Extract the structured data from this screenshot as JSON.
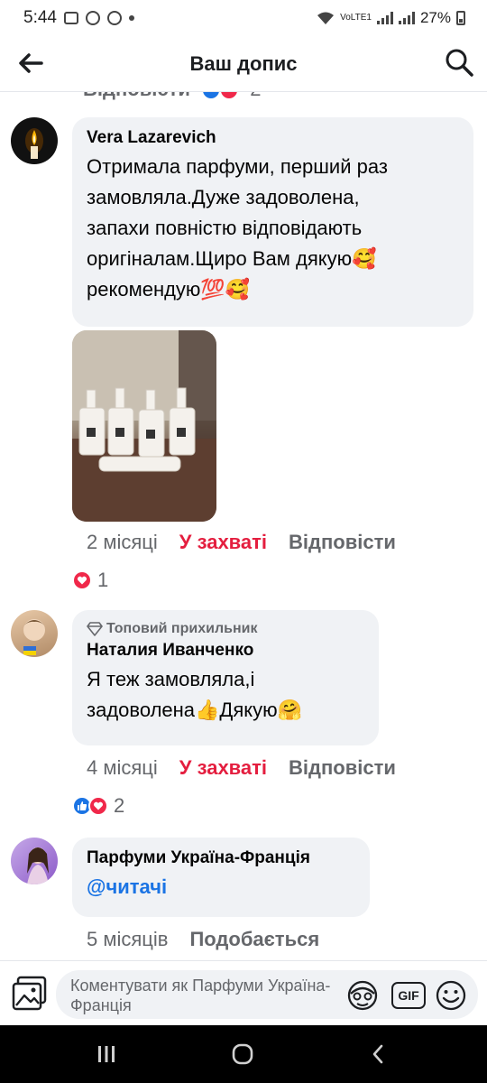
{
  "status_bar": {
    "time": "5:44",
    "network": "VoLTE1",
    "battery": "27%"
  },
  "header": {
    "title": "Ваш допис"
  },
  "previous_comment": {
    "cut_text": "Відповісти",
    "reactions_count": "2"
  },
  "comments": [
    {
      "author": "Vera Lazarevich",
      "text_lines": [
        "Отримала парфуми, перший  раз",
        "замовляла.Дуже задоволена,",
        "запахи повністю відповідають",
        "оригіналам.Щиро Вам дякую🥰",
        "рекомендую💯🥰"
      ],
      "time": "2 місяці",
      "like_label": "У захваті",
      "reply_label": "Відповісти",
      "reactions_count": "1"
    },
    {
      "badge": "Топовий прихильник",
      "author": "Наталия Иванченко",
      "text_lines": [
        "Я теж замовляла,і",
        "задоволена👍Дякую🤗"
      ],
      "time": "4 місяці",
      "like_label": "У захваті",
      "reply_label": "Відповісти",
      "reactions_count": "2"
    },
    {
      "author": "Парфуми Україна-Франція",
      "mention": "@читачі",
      "time": "5 місяців",
      "like_label": "Подобається"
    }
  ],
  "composer": {
    "placeholder": "Коментувати як Парфуми Україна-Франція",
    "gif_label": "GIF"
  },
  "colors": {
    "liked": "#e41e3f",
    "link": "#1b74e4",
    "bubble": "#f0f2f5",
    "muted": "#65676b"
  }
}
